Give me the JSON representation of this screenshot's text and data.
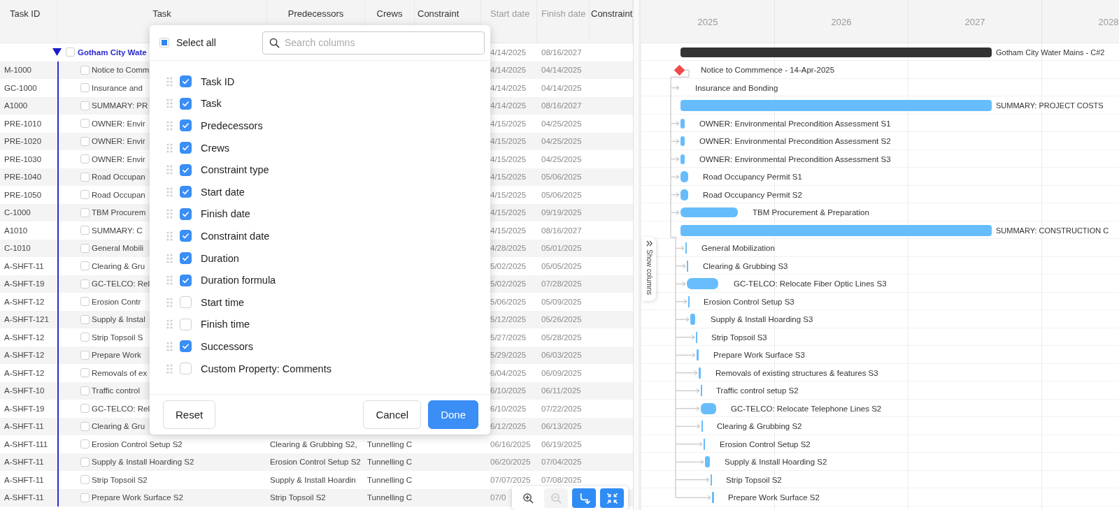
{
  "table": {
    "columns": [
      {
        "label": "Task ID",
        "dimmed": false
      },
      {
        "label": "Task",
        "dimmed": false
      },
      {
        "label": "Predecessors",
        "dimmed": false
      },
      {
        "label": "Crews",
        "dimmed": false
      },
      {
        "label": "Constraint",
        "dimmed": false
      },
      {
        "label": "Start date",
        "dimmed": true
      },
      {
        "label": "Finish date",
        "dimmed": true
      },
      {
        "label": "Constraint",
        "dimmed": false
      }
    ],
    "group": {
      "task": "Gotham City Wate",
      "expanded": true,
      "checked": false,
      "start": "4/14/2025",
      "finish": "08/16/2027"
    },
    "rows": [
      {
        "id": "M-1000",
        "task": "Notice to Comm",
        "checked": false,
        "start": "4/14/2025",
        "finish": "04/14/2025"
      },
      {
        "id": "GC-1000",
        "task": "Insurance and",
        "checked": false,
        "start": "4/14/2025",
        "finish": "04/14/2025"
      },
      {
        "id": "A1000",
        "task": "SUMMARY: PR",
        "checked": false,
        "start": "4/14/2025",
        "finish": "08/16/2027"
      },
      {
        "id": "PRE-1010",
        "task": "OWNER: Envir",
        "checked": false,
        "start": "4/15/2025",
        "finish": "04/25/2025"
      },
      {
        "id": "PRE-1020",
        "task": "OWNER: Envir",
        "checked": false,
        "start": "4/15/2025",
        "finish": "04/25/2025"
      },
      {
        "id": "PRE-1030",
        "task": "OWNER: Envir",
        "checked": false,
        "start": "4/15/2025",
        "finish": "04/25/2025"
      },
      {
        "id": "PRE-1040",
        "task": "Road Occupan",
        "checked": false,
        "start": "4/15/2025",
        "finish": "05/06/2025"
      },
      {
        "id": "PRE-1050",
        "task": "Road Occupan",
        "checked": false,
        "start": "4/15/2025",
        "finish": "05/06/2025"
      },
      {
        "id": "C-1000",
        "task": "TBM Procurem",
        "checked": false,
        "start": "4/15/2025",
        "finish": "09/19/2025"
      },
      {
        "id": "A1010",
        "task": "SUMMARY: C",
        "checked": false,
        "start": "4/15/2025",
        "finish": "08/16/2027"
      },
      {
        "id": "C-1010",
        "task": "General Mobili",
        "checked": false,
        "start": "4/28/2025",
        "finish": "05/01/2025"
      },
      {
        "id": "A-SHFT-11",
        "task": "Clearing & Gru",
        "checked": false,
        "start": "5/02/2025",
        "finish": "05/05/2025"
      },
      {
        "id": "A-SHFT-19",
        "task": "GC-TELCO: Rel",
        "checked": false,
        "start": "5/02/2025",
        "finish": "07/28/2025"
      },
      {
        "id": "A-SHFT-12",
        "task": "Erosion Contr",
        "checked": false,
        "start": "5/06/2025",
        "finish": "05/09/2025"
      },
      {
        "id": "A-SHFT-121",
        "task": "Supply & Instal",
        "checked": false,
        "start": "5/12/2025",
        "finish": "05/26/2025"
      },
      {
        "id": "A-SHFT-12",
        "task": "Strip Topsoil S",
        "checked": false,
        "start": "5/27/2025",
        "finish": "05/28/2025"
      },
      {
        "id": "A-SHFT-12",
        "task": "Prepare Work",
        "checked": false,
        "start": "5/29/2025",
        "finish": "06/03/2025"
      },
      {
        "id": "A-SHFT-12",
        "task": "Removals of ex",
        "checked": false,
        "start": "6/04/2025",
        "finish": "06/09/2025"
      },
      {
        "id": "A-SHFT-10",
        "task": "Traffic control",
        "checked": false,
        "start": "6/10/2025",
        "finish": "06/11/2025"
      },
      {
        "id": "A-SHFT-19",
        "task": "GC-TELCO: Rel",
        "checked": false,
        "start": "6/10/2025",
        "finish": "07/22/2025"
      },
      {
        "id": "A-SHFT-11",
        "task": "Clearing & Gru",
        "checked": false,
        "start": "6/12/2025",
        "finish": "06/13/2025"
      },
      {
        "id": "A-SHFT-111",
        "task": "Erosion Control Setup S2",
        "predecessors": "Clearing & Grubbing S2,",
        "crews": "Tunnelling C",
        "checked": false,
        "start": "06/16/2025",
        "finish": "06/19/2025"
      },
      {
        "id": "A-SHFT-11",
        "task": "Supply & Install Hoarding S2",
        "predecessors": "Erosion Control Setup S2",
        "crews": "Tunnelling C",
        "checked": false,
        "start": "06/20/2025",
        "finish": "07/04/2025"
      },
      {
        "id": "A-SHFT-11",
        "task": "Strip Topsoil S2",
        "predecessors": "Supply & Install Hoardin",
        "crews": "Tunnelling C",
        "checked": false,
        "start": "07/07/2025",
        "finish": "07/08/2025"
      },
      {
        "id": "A-SHFT-11",
        "task": "Prepare Work Surface S2",
        "predecessors": "Strip Topsoil S2",
        "crews": "Tunnelling C",
        "checked": false,
        "start": "07/0"
      }
    ]
  },
  "show_columns_tab": {
    "label": "Show columns"
  },
  "gantt": {
    "years": [
      "2025",
      "2026",
      "2027",
      "2028"
    ],
    "rows": [
      {
        "kind": "project",
        "label": "Gotham City Water Mains - C#2"
      },
      {
        "kind": "milestone",
        "label": "Notice to Commmence - 14-Apr-2025"
      },
      {
        "kind": "task",
        "label": "Insurance and Bonding"
      },
      {
        "kind": "summary",
        "label": "SUMMARY: PROJECT COSTS"
      },
      {
        "kind": "task",
        "label": "OWNER: Environmental Precondition Assessment S1"
      },
      {
        "kind": "task",
        "label": "OWNER: Environmental Precondition Assessment S2"
      },
      {
        "kind": "task",
        "label": "OWNER: Environmental Precondition Assessment S3"
      },
      {
        "kind": "task",
        "label": "Road Occupancy Permit S1"
      },
      {
        "kind": "task",
        "label": "Road Occupancy Permit S2"
      },
      {
        "kind": "task",
        "label": "TBM Procurement & Preparation"
      },
      {
        "kind": "summary",
        "label": "SUMMARY: CONSTRUCTION C"
      },
      {
        "kind": "task",
        "label": "General Mobilization"
      },
      {
        "kind": "task",
        "label": "Clearing & Grubbing S3"
      },
      {
        "kind": "task",
        "label": "GC-TELCO: Relocate Fiber Optic Lines S3"
      },
      {
        "kind": "task",
        "label": "Erosion Control Setup S3"
      },
      {
        "kind": "task",
        "label": "Supply & Install Hoarding S3"
      },
      {
        "kind": "task",
        "label": "Strip Topsoil S3"
      },
      {
        "kind": "task",
        "label": "Prepare Work Surface S3"
      },
      {
        "kind": "task",
        "label": "Removals of existing structures & features S3"
      },
      {
        "kind": "task",
        "label": "Traffic control setup S2"
      },
      {
        "kind": "task",
        "label": "GC-TELCO: Relocate Telephone Lines S2"
      },
      {
        "kind": "task",
        "label": "Clearing & Grubbing S2"
      },
      {
        "kind": "task",
        "label": "Erosion Control Setup S2"
      },
      {
        "kind": "task",
        "label": "Supply & Install Hoarding S2"
      },
      {
        "kind": "task",
        "label": "Strip Topsoil S2"
      },
      {
        "kind": "task",
        "label": "Prepare Work Surface S2"
      }
    ]
  },
  "column_dialog": {
    "select_all": {
      "label": "Select all",
      "checked": false,
      "indeterminate": true
    },
    "search": {
      "placeholder": "Search columns"
    },
    "items": [
      {
        "label": "Task ID",
        "checked": true
      },
      {
        "label": "Task",
        "checked": true
      },
      {
        "label": "Predecessors",
        "checked": true
      },
      {
        "label": "Crews",
        "checked": true
      },
      {
        "label": "Constraint type",
        "checked": true
      },
      {
        "label": "Start date",
        "checked": true
      },
      {
        "label": "Finish date",
        "checked": true
      },
      {
        "label": "Constraint date",
        "checked": true
      },
      {
        "label": "Duration",
        "checked": true
      },
      {
        "label": "Duration formula",
        "checked": true
      },
      {
        "label": "Start time",
        "checked": false
      },
      {
        "label": "Finish time",
        "checked": false
      },
      {
        "label": "Successors",
        "checked": true
      },
      {
        "label": "Custom Property: Comments",
        "checked": false
      }
    ],
    "buttons": [
      {
        "label": "Reset",
        "kind": "secondary"
      },
      {
        "label": "Cancel",
        "kind": "secondary"
      },
      {
        "label": "Done",
        "kind": "primary"
      }
    ]
  },
  "toolbar": [
    {
      "kind": "zoom-in",
      "on": false,
      "disabled": false
    },
    {
      "kind": "zoom-out",
      "on": false,
      "disabled": true
    },
    {
      "kind": "dependencies",
      "on": true,
      "disabled": false
    },
    {
      "kind": "fit",
      "on": true,
      "disabled": false
    }
  ]
}
